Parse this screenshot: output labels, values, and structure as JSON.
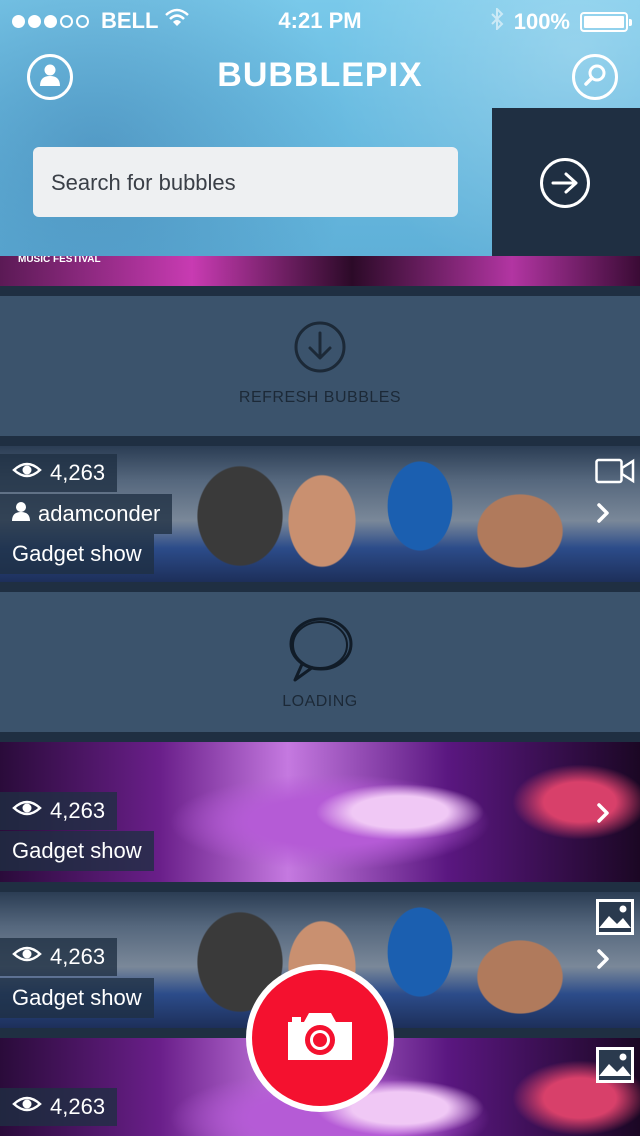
{
  "status_bar": {
    "carrier": "BELL",
    "time": "4:21 PM",
    "battery": "100%",
    "signal_bars_filled": 3,
    "signal_bars_total": 5
  },
  "header": {
    "title": "BUBBLEPIX",
    "profile_icon": "user-icon",
    "search_icon": "search-icon"
  },
  "search": {
    "placeholder": "Search for bubbles",
    "go_icon": "arrow-right-circle-icon"
  },
  "feed": {
    "top_strip_label": "MUSIC FESTIVAL",
    "refresh_label": "REFRESH BUBBLES",
    "loading_label": "LOADING",
    "items": [
      {
        "views": "4,263",
        "user": "adamconder",
        "title": "Gadget show",
        "media": "video-icon"
      },
      {
        "views": "4,263",
        "title": "Gadget show"
      },
      {
        "views": "4,263",
        "title": "Gadget show",
        "media": "image-icon"
      },
      {
        "views": "4,263",
        "media": "image-icon"
      }
    ]
  },
  "colors": {
    "header": "#6bbde2",
    "panel": "#3b536c",
    "background": "#1f2f42",
    "camera_button": "#f4112f"
  }
}
